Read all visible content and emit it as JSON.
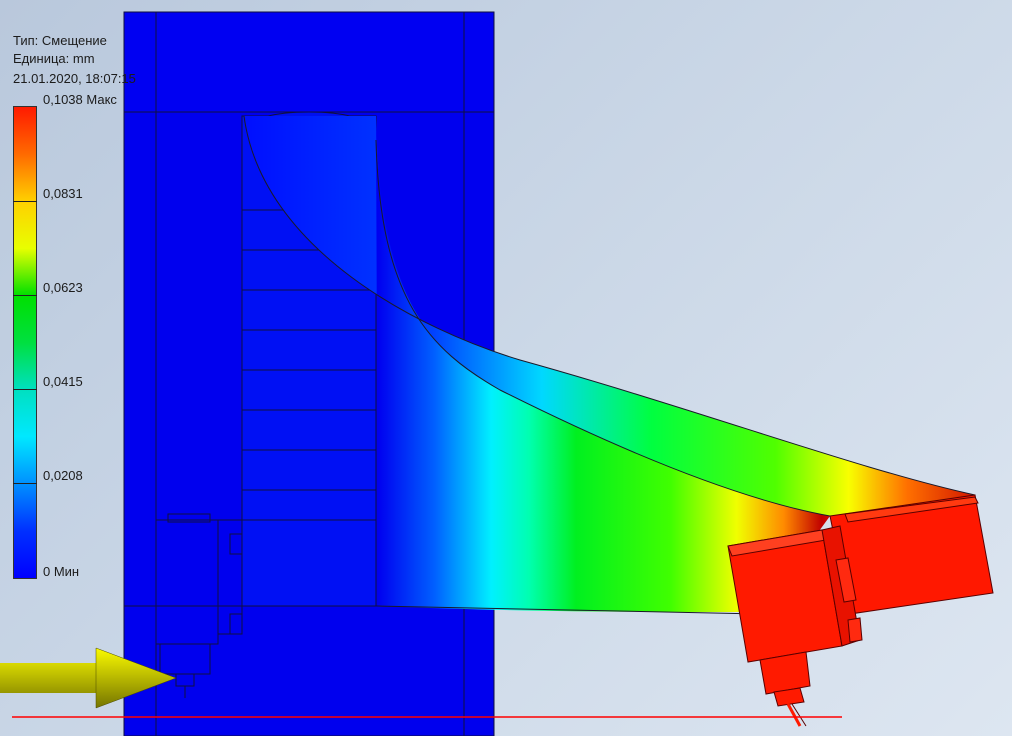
{
  "result_info": {
    "type_label": "Тип: Смещение",
    "unit_label": "Единица: mm",
    "timestamp": "21.01.2020, 18:07:15"
  },
  "legend": {
    "labels": [
      "0,1038 Макс",
      "0,0831",
      "0,0623",
      "0,0415",
      "0,0208",
      "0 Мин"
    ],
    "max_value": 0.1038,
    "min_value": 0
  },
  "colors": {
    "min": "#0000ff",
    "max": "#ff1a00",
    "reference_line": "#ff0000",
    "force_arrow": "#b8b800"
  }
}
